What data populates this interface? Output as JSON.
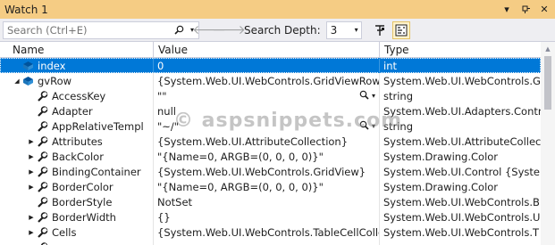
{
  "window": {
    "title": "Watch 1"
  },
  "toolbar": {
    "search_placeholder": "Search (Ctrl+E)",
    "search_depth_label": "Search Depth:",
    "search_depth_value": "3"
  },
  "columns": {
    "name": "Name",
    "value": "Value",
    "type": "Type"
  },
  "rows": [
    {
      "name": "index",
      "value": "0",
      "type": "int",
      "expander": "none",
      "icon": "field-icon",
      "selected": true
    },
    {
      "name": "gvRow",
      "value": "{System.Web.UI.WebControls.GridViewRow}",
      "type": "System.Web.UI.WebControls.G",
      "expander": "expanded",
      "icon": "field-icon"
    },
    {
      "name": "AccessKey",
      "value": "\"\"",
      "type": "string",
      "expander": "none",
      "icon": "property-icon",
      "has_visualizer": true
    },
    {
      "name": "Adapter",
      "value": "null",
      "type": "System.Web.UI.Adapters.Contr",
      "expander": "none",
      "icon": "property-icon"
    },
    {
      "name": "AppRelativeTempl",
      "value": "\"~/\"",
      "type": "string",
      "expander": "none",
      "icon": "property-icon",
      "has_visualizer": true
    },
    {
      "name": "Attributes",
      "value": "{System.Web.UI.AttributeCollection}",
      "type": "System.Web.UI.AttributeCollec",
      "expander": "collapsed",
      "icon": "property-icon"
    },
    {
      "name": "BackColor",
      "value": "\"{Name=0, ARGB=(0, 0, 0, 0)}\"",
      "type": "System.Drawing.Color",
      "expander": "collapsed",
      "icon": "property-icon"
    },
    {
      "name": "BindingContainer",
      "value": "{System.Web.UI.WebControls.GridView}",
      "type": "System.Web.UI.Control {Syste",
      "expander": "collapsed",
      "icon": "property-icon"
    },
    {
      "name": "BorderColor",
      "value": "\"{Name=0, ARGB=(0, 0, 0, 0)}\"",
      "type": "System.Drawing.Color",
      "expander": "collapsed",
      "icon": "property-icon"
    },
    {
      "name": "BorderStyle",
      "value": "NotSet",
      "type": "System.Web.UI.WebControls.B",
      "expander": "none",
      "icon": "property-icon"
    },
    {
      "name": "BorderWidth",
      "value": "{}",
      "type": "System.Web.UI.WebControls.U",
      "expander": "collapsed",
      "icon": "property-icon"
    },
    {
      "name": "Cells",
      "value": "{System.Web.UI.WebControls.TableCellCollec",
      "type": "System.Web.UI.WebControls.T",
      "expander": "collapsed",
      "icon": "property-icon"
    },
    {
      "name": "",
      "value": "",
      "type": "",
      "expander": "collapsed",
      "icon": "property-icon"
    }
  ],
  "watermark": "© aspsnippets.com",
  "colors": {
    "title_bar": "#f5cc84",
    "selection": "#0078d7",
    "toolbar": "#eeeef2"
  }
}
